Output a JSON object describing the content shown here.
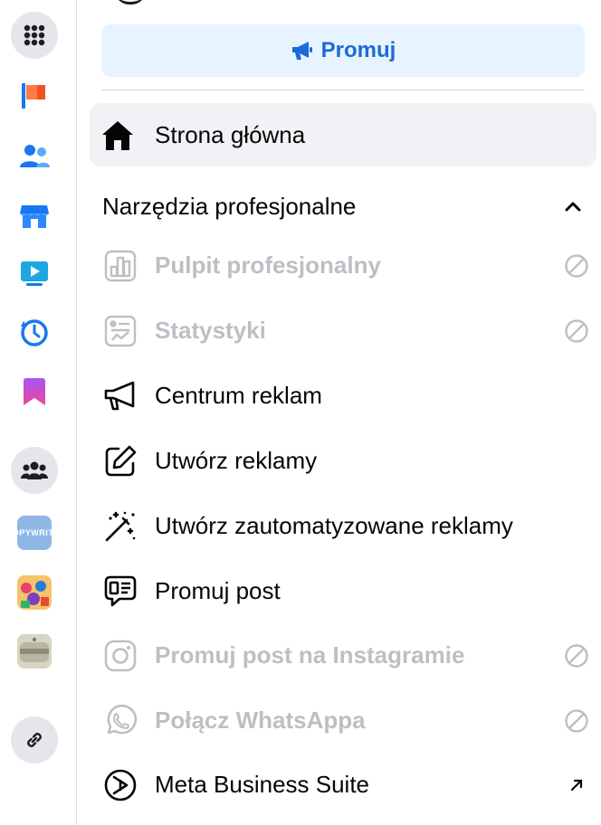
{
  "sidebar": {
    "items": [
      {
        "name": "apps-grid-icon"
      },
      {
        "name": "flag-icon"
      },
      {
        "name": "friends-icon"
      },
      {
        "name": "marketplace-icon"
      },
      {
        "name": "video-icon"
      },
      {
        "name": "memories-icon"
      },
      {
        "name": "saved-icon"
      },
      {
        "name": "groups-icon"
      },
      {
        "name": "shortcut-copywriting"
      },
      {
        "name": "shortcut-colorful-group"
      },
      {
        "name": "shortcut-product-group"
      },
      {
        "name": "link-icon"
      }
    ],
    "thumb_text": "OPYWRITI"
  },
  "promote_button": {
    "label": "Promuj"
  },
  "home": {
    "label": "Strona główna"
  },
  "section": {
    "title": "Narzędzia profesjonalne"
  },
  "tools": [
    {
      "label": "Pulpit profesjonalny",
      "state": "disabled",
      "icon": "dashboard-icon"
    },
    {
      "label": "Statystyki",
      "state": "disabled",
      "icon": "insights-icon"
    },
    {
      "label": "Centrum reklam",
      "state": "enabled",
      "icon": "megaphone-icon"
    },
    {
      "label": "Utwórz reklamy",
      "state": "enabled",
      "icon": "edit-icon"
    },
    {
      "label": "Utwórz zautomatyzowane reklamy",
      "state": "enabled",
      "icon": "magic-wand-icon"
    },
    {
      "label": "Promuj post",
      "state": "enabled",
      "icon": "promote-post-icon"
    },
    {
      "label": "Promuj post na Instagramie",
      "state": "disabled",
      "icon": "instagram-icon"
    },
    {
      "label": "Połącz WhatsAppa",
      "state": "disabled",
      "icon": "whatsapp-icon"
    },
    {
      "label": "Meta Business Suite",
      "state": "enabled",
      "icon": "meta-business-suite-icon"
    }
  ],
  "colors": {
    "accent": "#1b6bd6",
    "accent_bg": "#e7f3ff",
    "disabled_text": "#bcc0c4",
    "hover_bg": "#f0f2f5"
  }
}
